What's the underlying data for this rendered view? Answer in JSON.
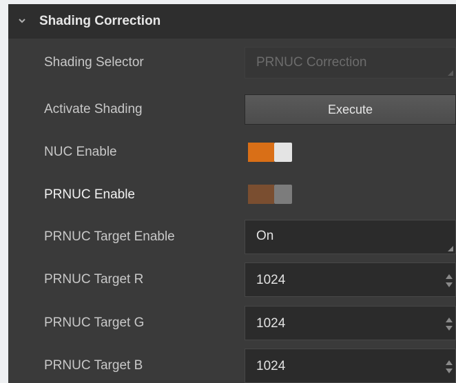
{
  "section": {
    "title": "Shading Correction",
    "expanded": true,
    "icon": "chevron-down-icon"
  },
  "colors": {
    "accent": "#d96f17",
    "accent_dim": "#7a4e30",
    "panel_bg": "#3a3a3a",
    "header_bg": "#2e2e2e"
  },
  "rows": {
    "shading_selector": {
      "label": "Shading Selector",
      "value": "PRNUC Correction",
      "enabled": false
    },
    "activate_shading": {
      "label": "Activate Shading",
      "button": "Execute"
    },
    "nuc_enable": {
      "label": "NUC Enable",
      "checked": true
    },
    "prnuc_enable": {
      "label": "PRNUC Enable",
      "checked": true,
      "enabled": false
    },
    "prnuc_target_enable": {
      "label": "PRNUC Target Enable",
      "value": "On"
    },
    "prnuc_target_r": {
      "label": "PRNUC Target R",
      "value": "1024"
    },
    "prnuc_target_g": {
      "label": "PRNUC Target G",
      "value": "1024"
    },
    "prnuc_target_b": {
      "label": "PRNUC Target B",
      "value": "1024"
    }
  }
}
